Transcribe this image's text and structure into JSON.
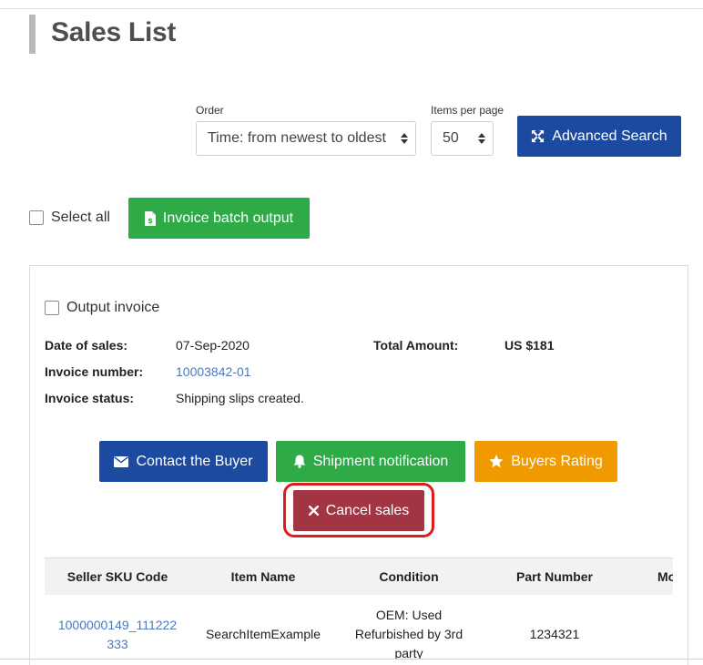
{
  "page": {
    "title": "Sales List"
  },
  "controls": {
    "order_label": "Order",
    "order_value": "Time: from newest to oldest",
    "per_page_label": "Items per page",
    "per_page_value": "50",
    "advanced_search_label": "Advanced Search"
  },
  "bulk": {
    "select_all_label": "Select all",
    "invoice_batch_label": "Invoice batch output"
  },
  "order_card": {
    "output_invoice_label": "Output invoice",
    "date_label": "Date of sales:",
    "date_value": "07-Sep-2020",
    "total_label": "Total Amount:",
    "total_value": "US $181",
    "invoice_number_label": "Invoice number:",
    "invoice_number_value": "10003842-01",
    "status_label": "Invoice status:",
    "status_value": "Shipping slips created.",
    "buttons": {
      "contact": "Contact the Buyer",
      "shipment": "Shipment notification",
      "rating": "Buyers Rating",
      "cancel": "Cancel sales"
    },
    "table": {
      "headers": [
        "Seller SKU Code",
        "Item Name",
        "Condition",
        "Part Number",
        "Mo"
      ],
      "row": {
        "sku_line1": "1000000149_111222",
        "sku_line2": "333",
        "item_name": "SearchItemExample",
        "condition_line1": "OEM: Used",
        "condition_line2": "Refurbished by 3rd",
        "condition_line3": "party",
        "part_number": "1234321"
      }
    }
  },
  "colors": {
    "primary_blue": "#1c4aa0",
    "green": "#2eaa47",
    "orange": "#f19a00",
    "cancel_red": "#a33444",
    "highlight_ring": "#e01b1b",
    "link_blue": "#4a78c2"
  },
  "icons": {
    "advanced_search": "expand-arrows-icon",
    "invoice_batch": "file-invoice-icon",
    "contact": "envelope-icon",
    "shipment": "bell-icon",
    "rating": "star-icon",
    "cancel": "times-icon"
  }
}
